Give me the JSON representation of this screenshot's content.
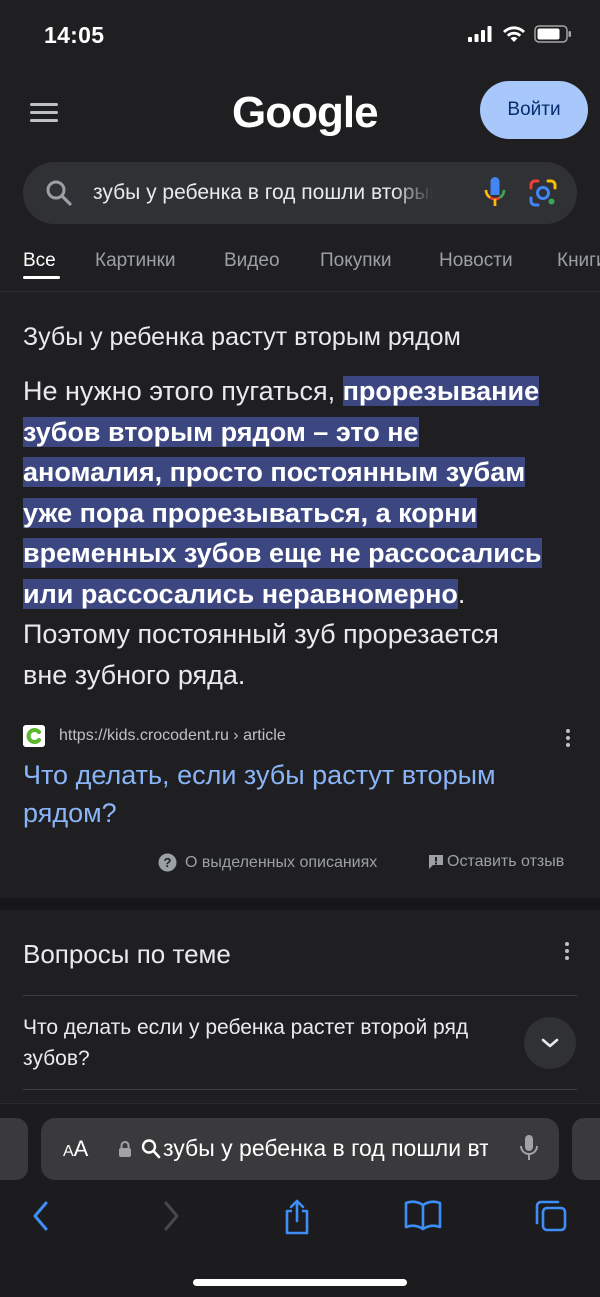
{
  "status": {
    "time": "14:05"
  },
  "header": {
    "logo": "Google",
    "signin_label": "Войти"
  },
  "search": {
    "query": "зубы у ребенка в год пошли вторым рядом"
  },
  "tabs": [
    "Все",
    "Картинки",
    "Видео",
    "Покупки",
    "Новости",
    "Книги"
  ],
  "snippet": {
    "title": "Зубы у ребенка растут вторым рядом",
    "text_before": "Не нужно этого пугаться, ",
    "highlight_lines": [
      "прорезывание",
      "зубов вторым рядом – это не",
      "аномалия, просто постоянным зубам",
      "уже пора прорезываться, а корни",
      "временных зубов еще не рассосались",
      "или рассосались неравномерно"
    ],
    "text_after_1": ".",
    "text_after_2": "Поэтому постоянный зуб прорезается",
    "text_after_3": "вне зубного ряда.",
    "source_url": "https://kids.crocodent.ru › article",
    "link_title": "Что делать, если зубы растут вторым рядом?",
    "about_label": "О выделенных описаниях",
    "feedback_label": "Оставить отзыв"
  },
  "related": {
    "title": "Вопросы по теме",
    "questions": [
      "Что делать если у ребенка растет второй ряд зубов?"
    ]
  },
  "safari": {
    "aa_label": "AA",
    "address_text": "зубы у ребенка в год пошли вторым рядом"
  },
  "colors": {
    "background": "#1f1f21",
    "link": "#8ab4f8",
    "highlight": "#3c4782",
    "signin_button": "#a8c7fa",
    "ios_blue": "#3e8ef7"
  }
}
